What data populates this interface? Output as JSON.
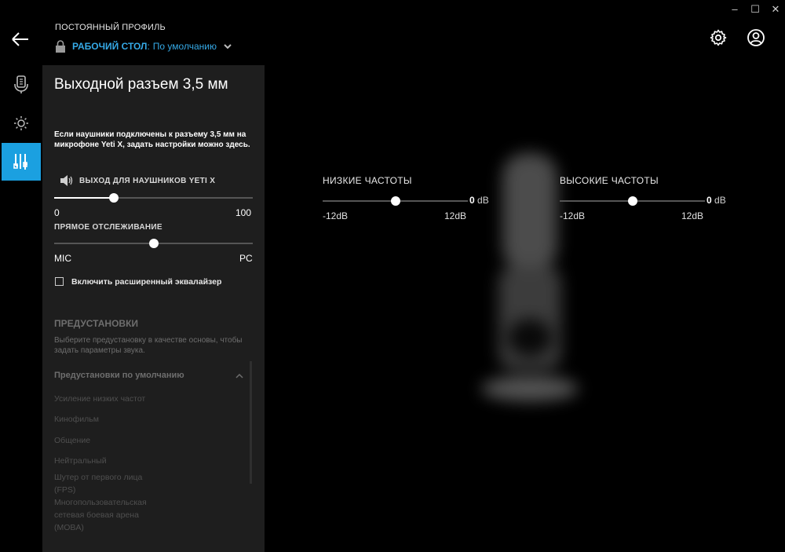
{
  "window": {
    "minimize": "–",
    "maximize": "☐",
    "close": "✕"
  },
  "header": {
    "profile_label": "ПОСТОЯННЫЙ ПРОФИЛЬ",
    "desktop_label": "РАБОЧИЙ СТОЛ",
    "colon": ":",
    "desktop_value": "По умолчанию"
  },
  "tabs": [
    {
      "icon": "microphone-icon",
      "active": false
    },
    {
      "icon": "brightness-icon",
      "active": false
    },
    {
      "icon": "audio-output-icon",
      "active": true
    }
  ],
  "panel": {
    "title": "Выходной разъем 3,5 мм",
    "description": "Если наушники подключены к разъему 3,5 мм на микрофоне Yeti X, задать настройки можно здесь.",
    "headphone_label": "ВЫХОД ДЛЯ НАУШНИКОВ YETI X",
    "headphone_min": "0",
    "headphone_max": "100",
    "headphone_value": 30,
    "monitoring_label": "ПРЯМОЕ ОТСЛЕЖИВАНИЕ",
    "monitoring_left": "MIC",
    "monitoring_right": "PC",
    "monitoring_value": 50,
    "advanced_eq_label": "Включить расширенный эквалайзер",
    "advanced_eq_checked": false,
    "presets_title": "ПРЕДУСТАНОВКИ",
    "presets_desc": "Выберите предустановку в качестве основы, чтобы задать параметры звука.",
    "presets_group": "Предустановки по умолчанию",
    "presets": [
      "Усиление низких частот",
      "Кинофильм",
      "Общение",
      "Нейтральный",
      "Шутер от первого лица (FPS)",
      "Многопользовательская сетевая боевая арена (MOBA)"
    ]
  },
  "eq": {
    "low": {
      "label": "НИЗКИЕ ЧАСТОТЫ",
      "value": "0",
      "unit": "dB",
      "min": "-12dB",
      "max": "12dB"
    },
    "high": {
      "label": "ВЫСОКИЕ ЧАСТОТЫ",
      "value": "0",
      "unit": "dB",
      "min": "-12dB",
      "max": "12dB"
    }
  },
  "colors": {
    "accent": "#1ba0e0",
    "link": "#35a9e6",
    "panel": "#1e1e1e",
    "background": "#000000"
  }
}
